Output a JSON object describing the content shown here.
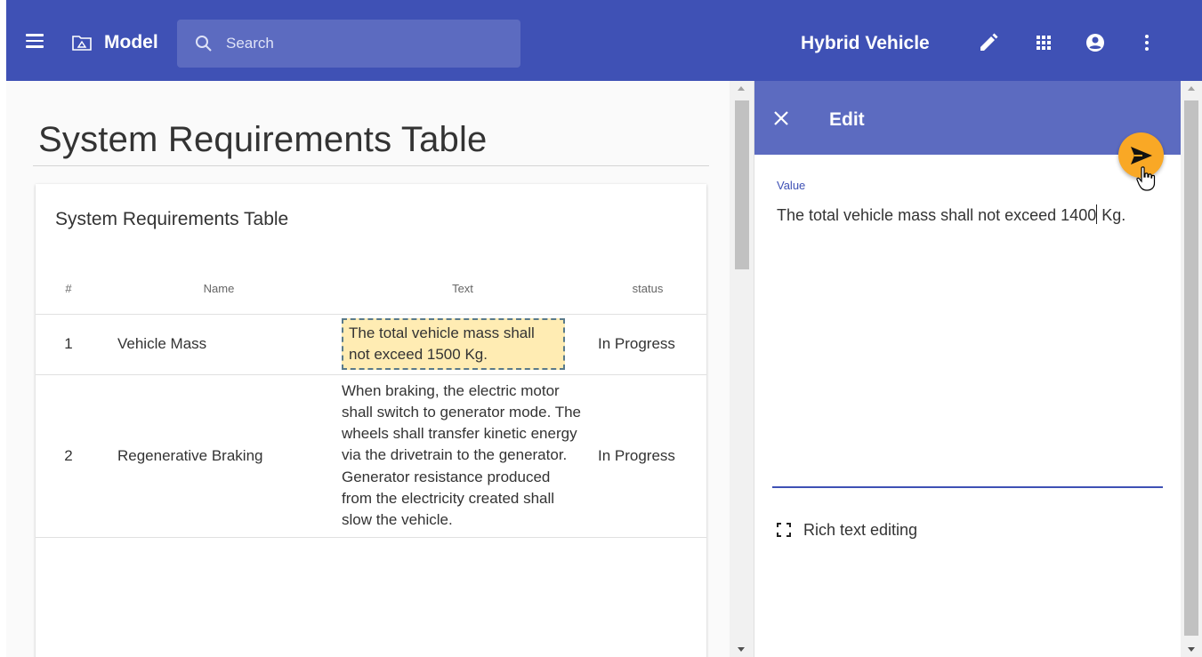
{
  "topbar": {
    "menu_icon": "hamburger-menu-icon",
    "model_icon": "model-folder-icon",
    "model_label": "Model",
    "search_placeholder": "Search",
    "project_title": "Hybrid Vehicle",
    "icons": [
      "edit-pencil-icon",
      "apps-grid-icon",
      "account-circle-icon",
      "more-vert-icon"
    ],
    "color": "#3f51b5"
  },
  "page": {
    "title": "System Requirements Table"
  },
  "table": {
    "title": "System Requirements Table",
    "columns": [
      "#",
      "Name",
      "Text",
      "status"
    ],
    "rows": [
      {
        "num": "1",
        "name": "Vehicle Mass",
        "text": "The total vehicle mass shall not exceed 1500 Kg.",
        "status": "In Progress",
        "highlighted": true
      },
      {
        "num": "2",
        "name": "Regenerative Braking",
        "text": "When braking, the electric motor shall switch to generator mode. The wheels shall transfer kinetic energy via the drivetrain to the generator. Generator resistance produced from the electricity created shall slow the vehicle.",
        "status": "In Progress",
        "highlighted": false
      }
    ],
    "highlight_color": "#ffecb3"
  },
  "edit_panel": {
    "title": "Edit",
    "close_icon": "close-icon",
    "send_icon": "send-icon",
    "value_label": "Value",
    "value_text": "The total vehicle mass shall not exceed 1400 Kg.",
    "rich_text_label": "Rich text editing",
    "header_color": "#5c6bc0",
    "accent_color": "#f9a825"
  }
}
